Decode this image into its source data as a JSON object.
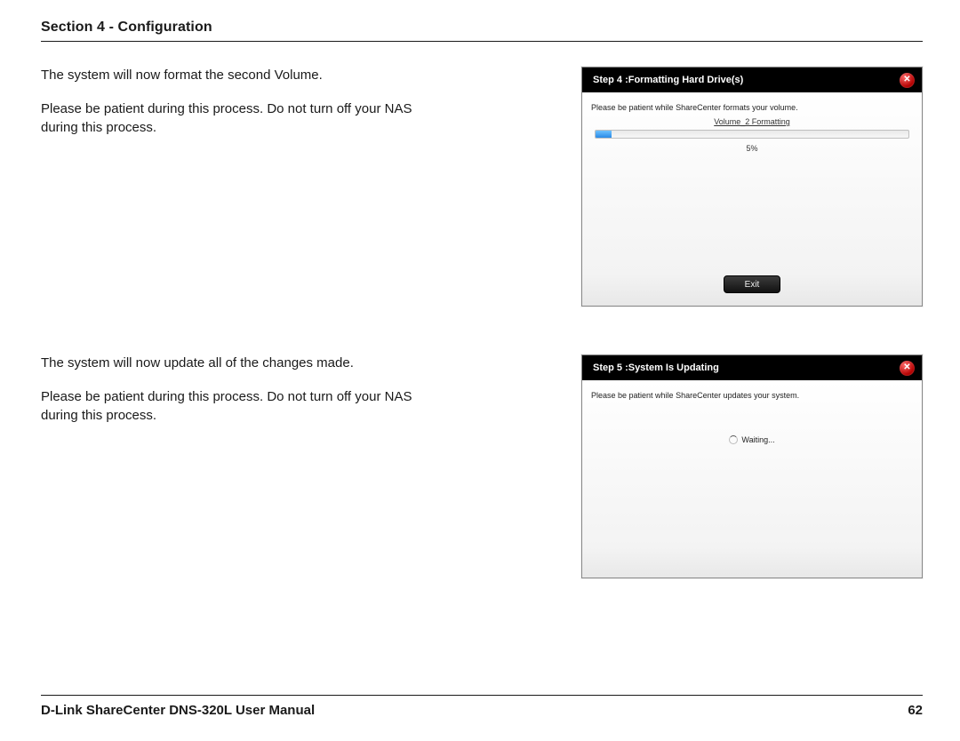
{
  "header": {
    "title": "Section 4 - Configuration"
  },
  "block1": {
    "p1": "The system will now format the second Volume.",
    "p2": "Please be patient during this process. Do not turn off your NAS during this process.",
    "dialog": {
      "title": "Step 4 :Formatting Hard Drive(s)",
      "instruction": "Please be patient while ShareCenter formats your volume.",
      "volumeLabel": "Volume_2 Formatting",
      "percent": "5%",
      "exit": "Exit"
    }
  },
  "block2": {
    "p1": "The system will now update all of the changes made.",
    "p2": "Please be patient during this process. Do not turn off your NAS during this process.",
    "dialog": {
      "title": "Step 5 :System Is Updating",
      "instruction": "Please be patient while ShareCenter updates your system.",
      "waiting": "Waiting..."
    }
  },
  "footer": {
    "manual": "D-Link ShareCenter DNS-320L User Manual",
    "page": "62"
  }
}
